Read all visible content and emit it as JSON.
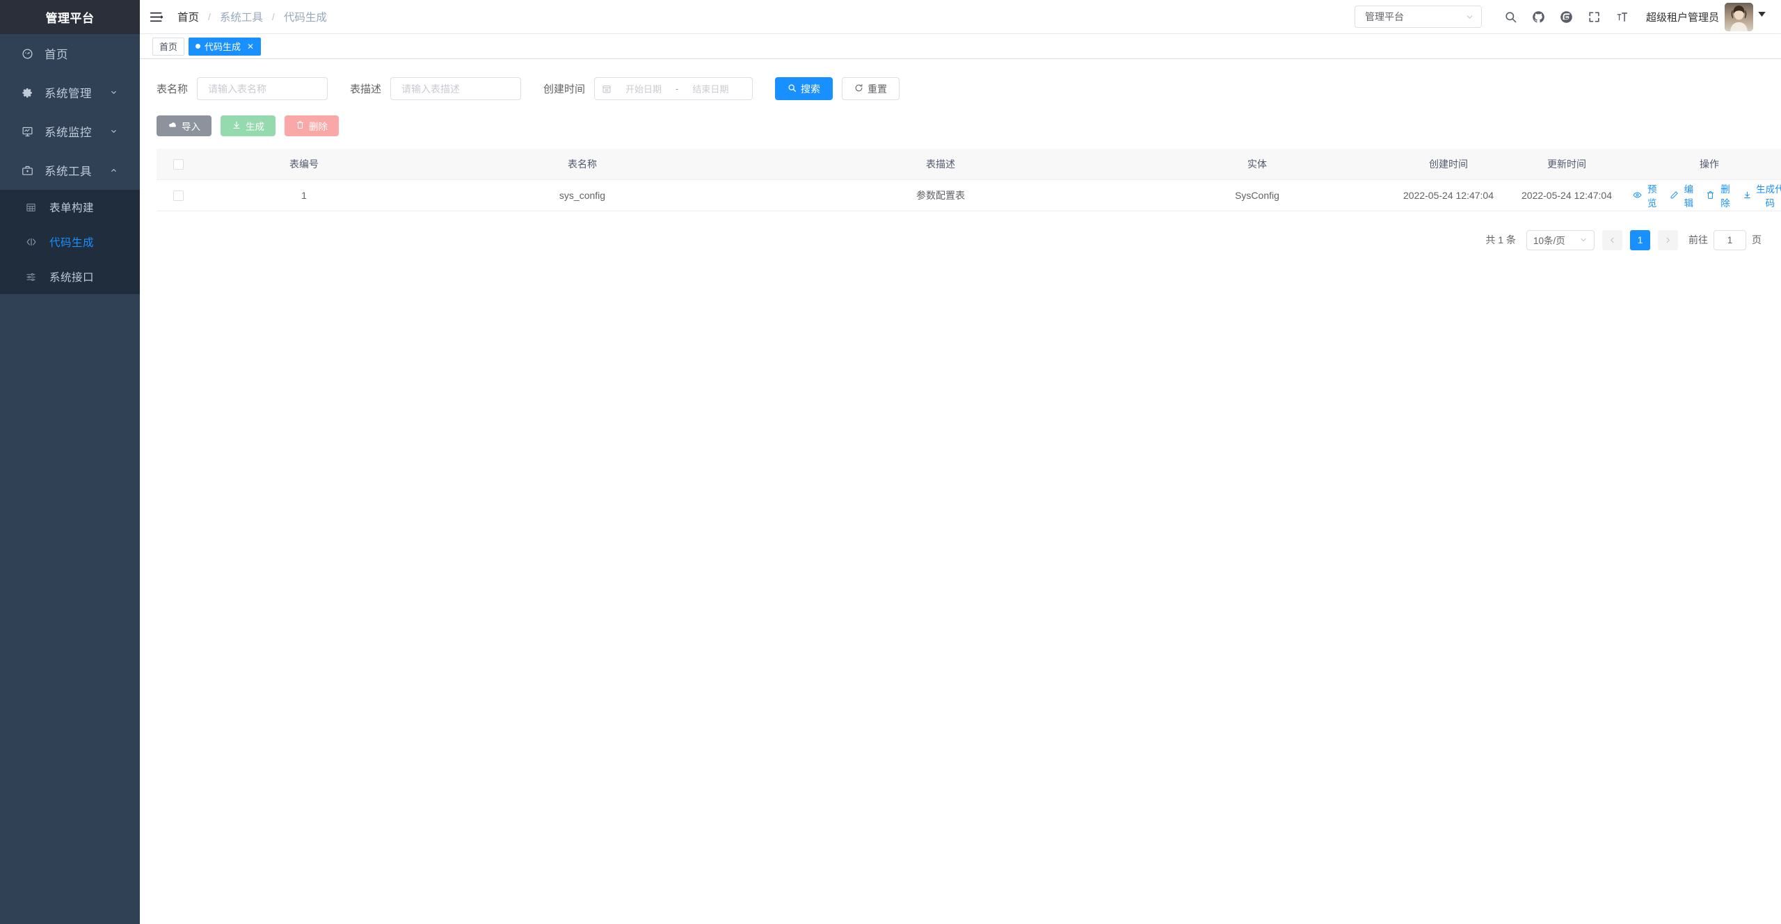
{
  "sidebar": {
    "logo": "管理平台",
    "items": [
      {
        "label": "首页",
        "icon": "dashboard-icon",
        "has_children": false
      },
      {
        "label": "系统管理",
        "icon": "gear-icon",
        "has_children": true,
        "expanded": false
      },
      {
        "label": "系统监控",
        "icon": "monitor-icon",
        "has_children": true,
        "expanded": false
      },
      {
        "label": "系统工具",
        "icon": "toolbox-icon",
        "has_children": true,
        "expanded": true
      }
    ],
    "submenu": [
      {
        "label": "表单构建",
        "icon": "table-grid-icon",
        "active": false
      },
      {
        "label": "代码生成",
        "icon": "code-icon",
        "active": true
      },
      {
        "label": "系统接口",
        "icon": "sliders-icon",
        "active": false
      }
    ]
  },
  "navbar": {
    "hamburger_icon": "hamburger-icon",
    "breadcrumb": [
      "首页",
      "系统工具",
      "代码生成"
    ],
    "tenant_select": {
      "value": "管理平台"
    },
    "icons": [
      "search-icon",
      "github-icon",
      "gitee-icon",
      "fullscreen-icon",
      "font-size-icon"
    ],
    "username": "超级租户管理员"
  },
  "tags": [
    {
      "label": "首页",
      "active": false,
      "closable": false
    },
    {
      "label": "代码生成",
      "active": true,
      "closable": true
    }
  ],
  "search_form": {
    "table_name": {
      "label": "表名称",
      "value": "",
      "placeholder": "请输入表名称"
    },
    "table_desc": {
      "label": "表描述",
      "value": "",
      "placeholder": "请输入表描述"
    },
    "create_time": {
      "label": "创建时间",
      "start_placeholder": "开始日期",
      "end_placeholder": "结束日期",
      "separator": "-"
    },
    "search_button": "搜索",
    "reset_button": "重置"
  },
  "toolbar": {
    "import_button": "导入",
    "generate_button": "生成",
    "delete_button": "删除"
  },
  "table": {
    "columns": [
      "表编号",
      "表名称",
      "表描述",
      "实体",
      "创建时间",
      "更新时间",
      "操作"
    ],
    "rows": [
      {
        "id": "1",
        "table_name": "sys_config",
        "table_desc": "参数配置表",
        "entity": "SysConfig",
        "create_time": "2022-05-24 12:47:04",
        "update_time": "2022-05-24 12:47:04",
        "actions": [
          "预览",
          "编辑",
          "删除",
          "生成代码"
        ]
      }
    ]
  },
  "pagination": {
    "total_text": "共 1 条",
    "page_size": "10条/页",
    "prev": "‹",
    "current_page": "1",
    "next": "›",
    "goto_label": "前往",
    "goto_value": "1",
    "page_unit": "页"
  },
  "colors": {
    "primary": "#1890ff",
    "sidebar_bg": "#304156",
    "submenu_bg": "#1f2d3d",
    "logo_bg": "#2b2f3a",
    "success": "#95d9ae",
    "danger": "#f9a7a7",
    "info": "#8c939d"
  }
}
